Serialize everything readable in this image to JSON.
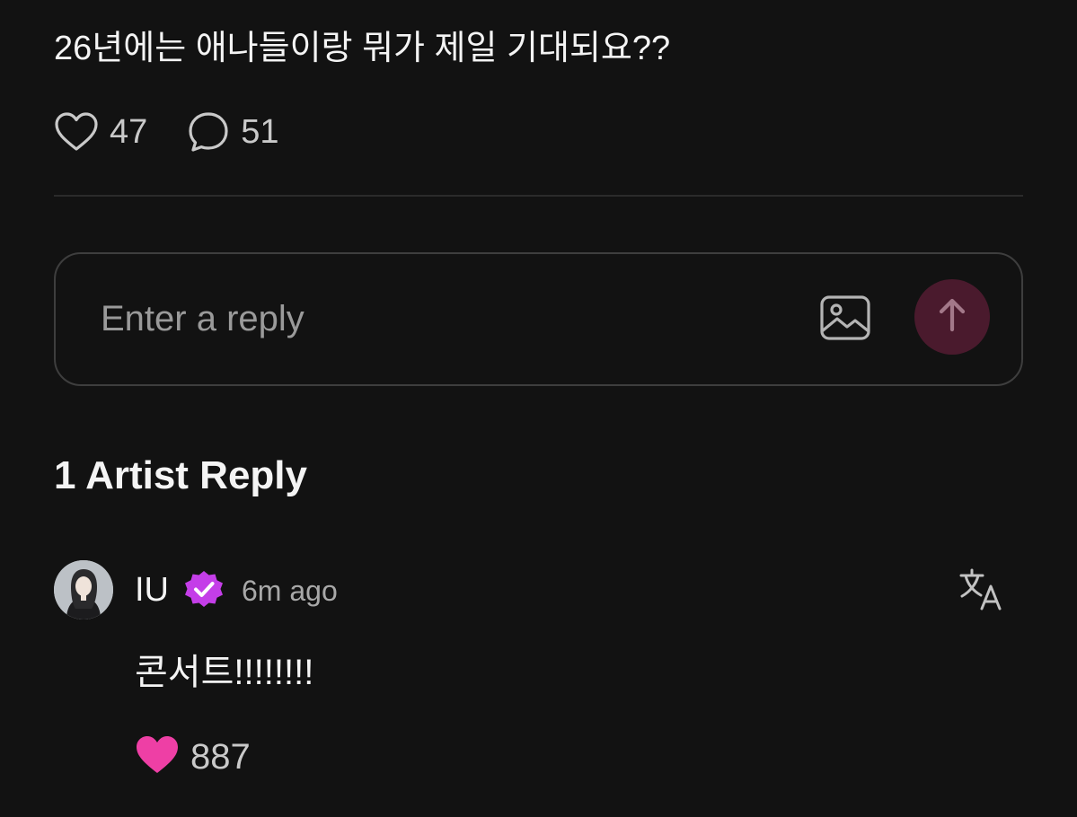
{
  "post": {
    "text": "26년에는 애나들이랑 뭐가 제일 기대되요??",
    "likes": "47",
    "comments": "51"
  },
  "reply_box": {
    "placeholder": "Enter a reply",
    "send_color": "#4a1a2d"
  },
  "artist_replies": {
    "title": "1 Artist Reply",
    "items": [
      {
        "author": "IU",
        "verified": true,
        "time": "6m ago",
        "text": "콘서트!!!!!!!!",
        "likes": "887",
        "liked": true
      }
    ]
  },
  "colors": {
    "background": "#121212",
    "like_active": "#ee3fa5",
    "verified_badge": "#c43ee8"
  },
  "icons": [
    "heart-icon",
    "comment-icon",
    "image-icon",
    "arrow-up-icon",
    "verified-icon",
    "translate-icon"
  ]
}
